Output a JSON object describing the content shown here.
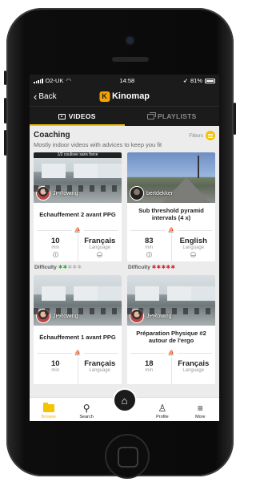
{
  "status_bar": {
    "carrier": "O2-UK",
    "time": "14:58",
    "battery": "81%"
  },
  "nav": {
    "back_label": "Back",
    "brand": "Kinomap",
    "brand_logo_letter": "K"
  },
  "tabs": [
    {
      "label": "VIDEOS",
      "active": true
    },
    {
      "label": "PLAYLISTS",
      "active": false
    }
  ],
  "section": {
    "title": "Coaching",
    "subtitle": "Mostly indoor videos with advices to keep you fit",
    "filters_label": "Filters"
  },
  "cards": [
    {
      "banner": "1/2 coulisse sans force",
      "owner": "JPRowing",
      "title": "Echauffement 2 avant PPG",
      "duration": "10",
      "duration_unit": "min",
      "language": "Français",
      "language_label": "Language",
      "sport_icon": "rowing-icon"
    },
    {
      "banner": "",
      "owner": "bertdekker",
      "title": "Sub threshold pyramid intervals (4 x)",
      "duration": "83",
      "duration_unit": "min",
      "language": "English",
      "language_label": "Language",
      "sport_icon": "rowing-icon"
    },
    {
      "banner": "",
      "owner": "JPRowing",
      "title": "Échauffement 1 avant PPG",
      "duration": "10",
      "duration_unit": "min",
      "language": "Français",
      "language_label": "Language",
      "sport_icon": "rowing-icon"
    },
    {
      "banner": "",
      "owner": "JPRowing",
      "title": "Préparation Physique #2 autour de l'ergo",
      "duration": "18",
      "duration_unit": "min",
      "language": "Français",
      "language_label": "Language",
      "sport_icon": "rowing-icon"
    }
  ],
  "difficulty": [
    {
      "label": "Difficulty",
      "level": 2,
      "max": 5,
      "color": "#3aa53a"
    },
    {
      "label": "Difficulty",
      "level": 5,
      "max": 5,
      "color": "#d4202a"
    }
  ],
  "tabbar": [
    {
      "label": "Browse",
      "icon": "folder-icon",
      "active": true
    },
    {
      "label": "Search",
      "icon": "search-icon",
      "active": false
    },
    {
      "label": "",
      "icon": "home-icon",
      "active": false
    },
    {
      "label": "Profile",
      "icon": "person-icon",
      "active": false
    },
    {
      "label": "More",
      "icon": "menu-icon",
      "active": false
    }
  ],
  "colors": {
    "accent": "#f5c400",
    "bar": "#1b1b1b",
    "screen_bg": "#ececec"
  }
}
